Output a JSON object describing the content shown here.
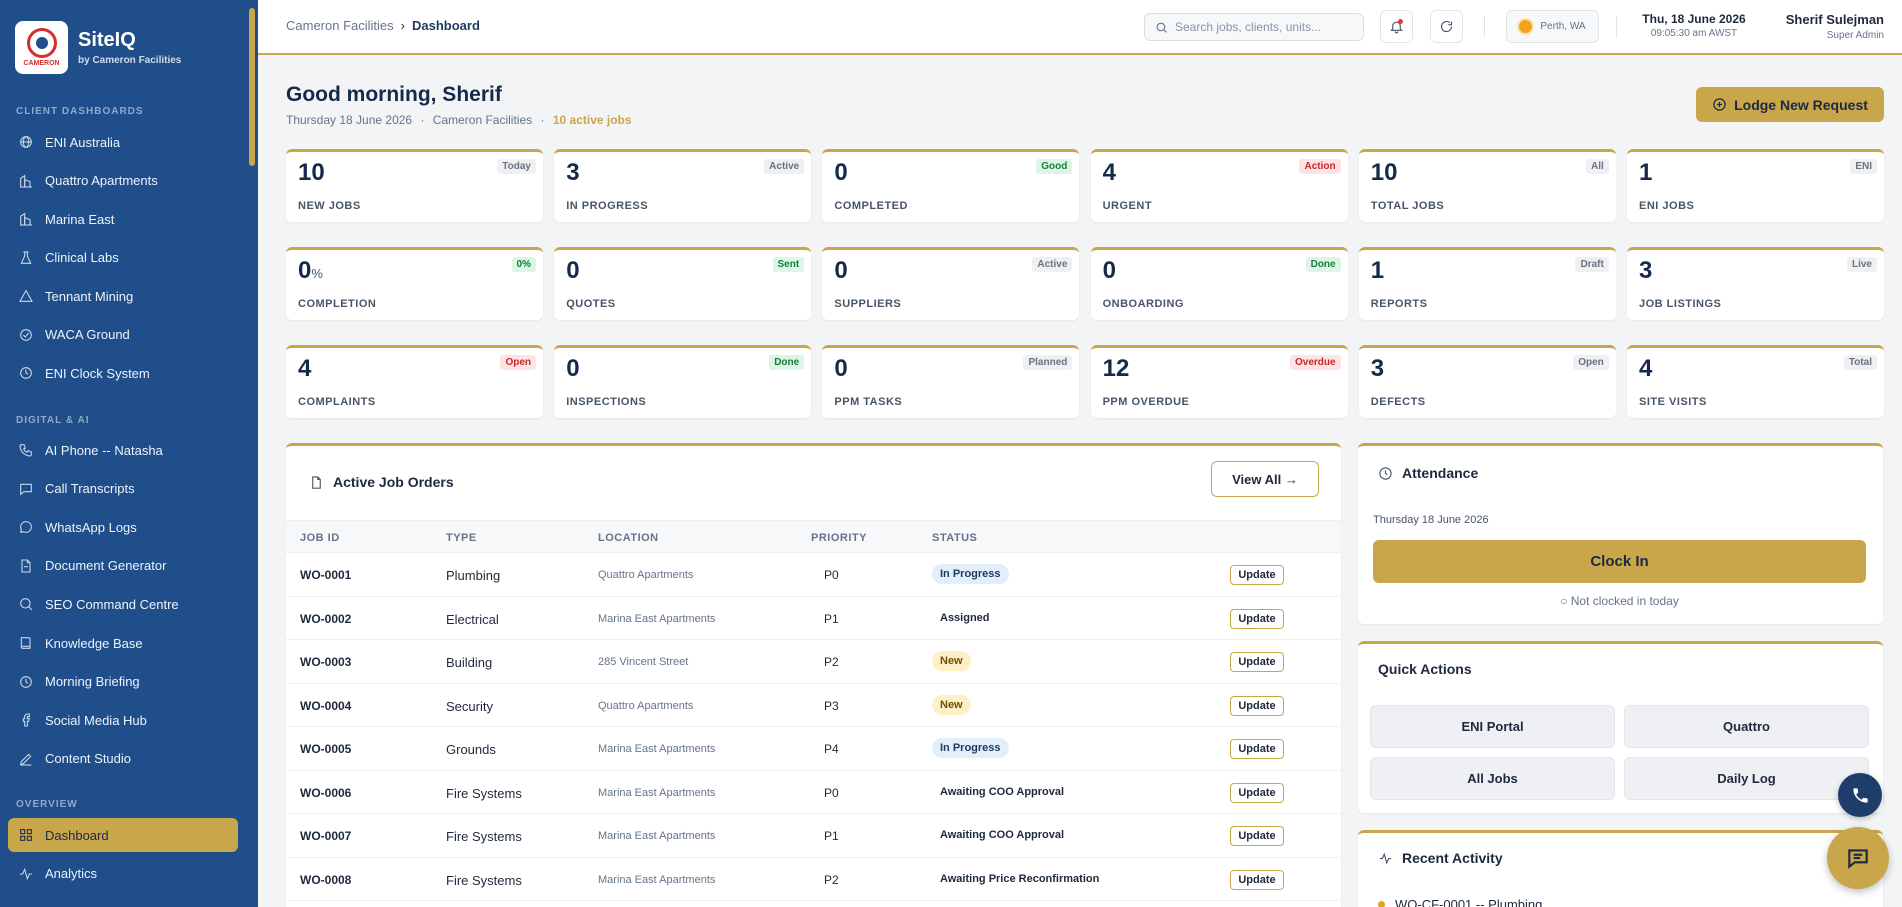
{
  "brand": {
    "name": "SiteIQ",
    "tagline": "by Cameron Facilities",
    "logo_text": "CAMERON"
  },
  "sidebar": {
    "sections": {
      "client": "CLIENT DASHBOARDS",
      "digital": "DIGITAL & AI",
      "overview": "OVERVIEW"
    },
    "client_items": [
      {
        "label": "ENI Australia",
        "icon": "globe-icon"
      },
      {
        "label": "Quattro Apartments",
        "icon": "building-icon"
      },
      {
        "label": "Marina East",
        "icon": "building-icon"
      },
      {
        "label": "Clinical Labs",
        "icon": "flask-icon"
      },
      {
        "label": "Tennant Mining",
        "icon": "triangle-icon"
      },
      {
        "label": "WACA Ground",
        "icon": "check-circle-icon"
      },
      {
        "label": "ENI Clock System",
        "icon": "clock-icon"
      }
    ],
    "digital_items": [
      {
        "label": "AI Phone -- Natasha",
        "icon": "phone-icon"
      },
      {
        "label": "Call Transcripts",
        "icon": "chat-icon"
      },
      {
        "label": "WhatsApp Logs",
        "icon": "message-circle-icon"
      },
      {
        "label": "Document Generator",
        "icon": "document-icon"
      },
      {
        "label": "SEO Command Centre",
        "icon": "search-icon"
      },
      {
        "label": "Knowledge Base",
        "icon": "book-icon"
      },
      {
        "label": "Morning Briefing",
        "icon": "clock-icon"
      },
      {
        "label": "Social Media Hub",
        "icon": "facebook-icon"
      },
      {
        "label": "Content Studio",
        "icon": "pen-icon"
      }
    ],
    "overview_items": [
      {
        "label": "Dashboard",
        "icon": "grid-icon",
        "active": true
      },
      {
        "label": "Analytics",
        "icon": "activity-icon"
      }
    ]
  },
  "topbar": {
    "breadcrumb_parent": "Cameron Facilities",
    "breadcrumb_current": "Dashboard",
    "search_placeholder": "Search jobs, clients, units...",
    "location": "Perth, WA",
    "date": "Thu, 18 June 2026",
    "time": "09:05:30 am AWST",
    "user_name": "Sherif Sulejman",
    "user_role": "Super Admin"
  },
  "greeting": {
    "title": "Good morning, Sherif",
    "date": "Thursday 18 June 2026",
    "company": "Cameron Facilities",
    "active_jobs": "10 active jobs",
    "sep": "·"
  },
  "lodge_button": "Lodge New Request",
  "stats": [
    {
      "value": "10",
      "label": "NEW JOBS",
      "badge": "Today",
      "tone": "grey"
    },
    {
      "value": "3",
      "label": "IN PROGRESS",
      "badge": "Active",
      "tone": "grey"
    },
    {
      "value": "0",
      "label": "COMPLETED",
      "badge": "Good",
      "tone": "green"
    },
    {
      "value": "4",
      "label": "URGENT",
      "badge": "Action",
      "tone": "red"
    },
    {
      "value": "10",
      "label": "TOTAL JOBS",
      "badge": "All",
      "tone": "grey"
    },
    {
      "value": "1",
      "label": "ENI JOBS",
      "badge": "ENI",
      "tone": "grey"
    },
    {
      "value": "0",
      "unit": "%",
      "label": "COMPLETION",
      "badge": "0%",
      "tone": "green"
    },
    {
      "value": "0",
      "label": "QUOTES",
      "badge": "Sent",
      "tone": "green"
    },
    {
      "value": "0",
      "label": "SUPPLIERS",
      "badge": "Active",
      "tone": "grey"
    },
    {
      "value": "0",
      "label": "ONBOARDING",
      "badge": "Done",
      "tone": "green"
    },
    {
      "value": "1",
      "label": "REPORTS",
      "badge": "Draft",
      "tone": "grey"
    },
    {
      "value": "3",
      "label": "JOB LISTINGS",
      "badge": "Live",
      "tone": "grey"
    },
    {
      "value": "4",
      "label": "COMPLAINTS",
      "badge": "Open",
      "tone": "red"
    },
    {
      "value": "0",
      "label": "INSPECTIONS",
      "badge": "Done",
      "tone": "green"
    },
    {
      "value": "0",
      "label": "PPM TASKS",
      "badge": "Planned",
      "tone": "grey"
    },
    {
      "value": "12",
      "label": "PPM OVERDUE",
      "badge": "Overdue",
      "tone": "red"
    },
    {
      "value": "3",
      "label": "DEFECTS",
      "badge": "Open",
      "tone": "grey"
    },
    {
      "value": "4",
      "label": "SITE VISITS",
      "badge": "Total",
      "tone": "grey"
    }
  ],
  "jobs": {
    "title": "Active Job Orders",
    "view_all": "View All →",
    "columns": [
      "JOB ID",
      "TYPE",
      "LOCATION",
      "PRIORITY",
      "STATUS"
    ],
    "update_label": "Update",
    "rows": [
      {
        "id": "WO-0001",
        "type": "Plumbing",
        "location": "Quattro Apartments",
        "priority": "P0",
        "status": "In Progress",
        "style": "inprog"
      },
      {
        "id": "WO-0002",
        "type": "Electrical",
        "location": "Marina East Apartments",
        "priority": "P1",
        "status": "Assigned",
        "style": "plain"
      },
      {
        "id": "WO-0003",
        "type": "Building",
        "location": "285 Vincent Street",
        "priority": "P2",
        "status": "New",
        "style": "new"
      },
      {
        "id": "WO-0004",
        "type": "Security",
        "location": "Quattro Apartments",
        "priority": "P3",
        "status": "New",
        "style": "new"
      },
      {
        "id": "WO-0005",
        "type": "Grounds",
        "location": "Marina East Apartments",
        "priority": "P4",
        "status": "In Progress",
        "style": "inprog"
      },
      {
        "id": "WO-0006",
        "type": "Fire Systems",
        "location": "Marina East Apartments",
        "priority": "P0",
        "status": "Awaiting COO Approval",
        "style": "plain"
      },
      {
        "id": "WO-0007",
        "type": "Fire Systems",
        "location": "Marina East Apartments",
        "priority": "P1",
        "status": "Awaiting COO Approval",
        "style": "plain"
      },
      {
        "id": "WO-0008",
        "type": "Fire Systems",
        "location": "Marina East Apartments",
        "priority": "P2",
        "status": "Awaiting Price Reconfirmation",
        "style": "plain"
      }
    ]
  },
  "attendance": {
    "title": "Attendance",
    "date": "Thursday 18 June 2026",
    "clock_in": "Clock In",
    "status": "○ Not clocked in today"
  },
  "quick_actions": {
    "title": "Quick Actions",
    "items": [
      "ENI Portal",
      "Quattro",
      "All Jobs",
      "Daily Log"
    ]
  },
  "recent_activity": {
    "title": "Recent Activity",
    "first_item": "WO-CF-0001 -- Plumbing"
  },
  "colors": {
    "sidebar": "#1f4e8a",
    "accent": "#c9a64a",
    "navy": "#15294a"
  }
}
